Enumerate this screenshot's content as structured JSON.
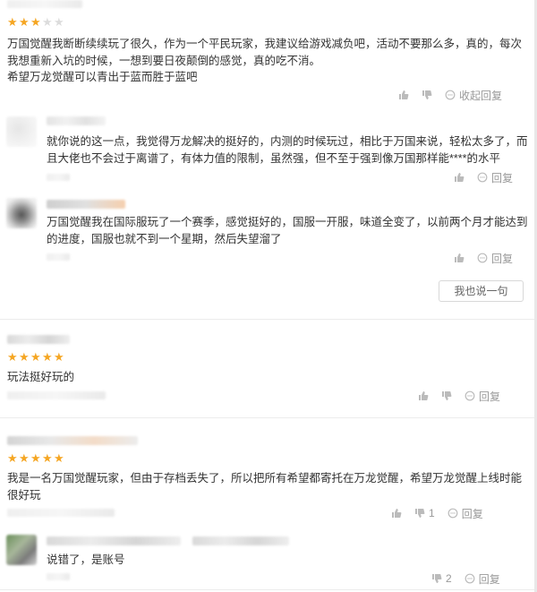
{
  "colors": {
    "star_on": "#f5a623",
    "star_off": "#dcdcdc",
    "action_gray": "#999999"
  },
  "reviews": [
    {
      "rating": 3,
      "body": "万国觉醒我断断续续玩了很久，作为一个平民玩家，我建议给游戏减负吧，活动不要那么多，真的，每次我想重新入坑的时候，一想到要日夜颠倒的感觉，真的吃不消。",
      "body2": "希望万龙觉醒可以青出于蓝而胜于蓝吧",
      "collapse_label": "收起回复",
      "replies": [
        {
          "body": "就你说的这一点，我觉得万龙解决的挺好的，内测的时候玩过，相比于万国来说，轻松太多了，而且大佬也不会过于离谱了，有体力值的限制，虽然强，但不至于强到像万国那样能****的水平",
          "reply_label": "回复"
        },
        {
          "body": "万国觉醒我在国际服玩了一个赛季，感觉挺好的，国服一开服，味道全变了，以前两个月才能达到的进度，国服也就不到一个星期，然后失望溜了",
          "reply_label": "回复"
        }
      ],
      "say_button": "我也说一句"
    },
    {
      "rating": 5,
      "body": "玩法挺好玩的",
      "reply_label": "回复"
    },
    {
      "rating": 5,
      "body": "我是一名万国觉醒玩家，但由于存档丢失了，所以把所有希望都寄托在万龙觉醒，希望万龙觉醒上线时能很好玩",
      "reply_label": "回复",
      "dislike_count": "1"
    },
    {
      "body": "说错了，是账号",
      "reply_label": "回复",
      "dislike_count": "2"
    }
  ],
  "icons": {
    "like": "thumb-up-icon",
    "dislike": "thumb-down-icon",
    "reply": "comment-icon"
  }
}
